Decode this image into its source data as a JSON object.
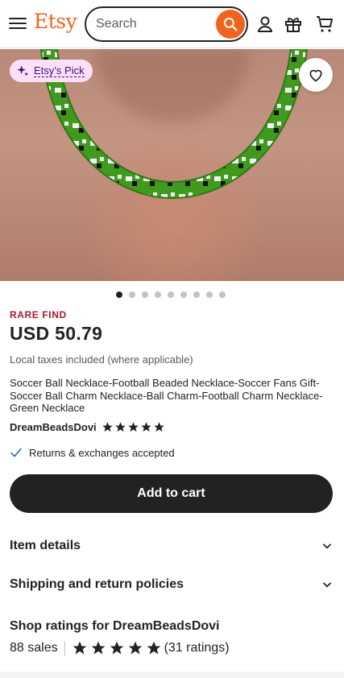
{
  "header": {
    "logo": "Etsy",
    "search_placeholder": "Search",
    "icons": [
      "hamburger-menu-icon",
      "search-icon",
      "account-icon",
      "gift-icon",
      "cart-icon"
    ]
  },
  "hero": {
    "badge_label": "Etsy’s Pick",
    "carousel": {
      "total": 9,
      "active": 1
    }
  },
  "listing": {
    "tag": "RARE FIND",
    "price": "USD 50.79",
    "taxes_note": "Local taxes included (where applicable)",
    "title": "Soccer Ball Necklace-Football Beaded Necklace-Soccer Fans Gift-Soccer Ball Charm Necklace-Ball Charm-Football Charm Necklace-Green Necklace",
    "shop_name": "DreamBeadsDovi",
    "shop_rating_stars": 5,
    "returns_note": "Returns & exchanges accepted",
    "add_to_cart_label": "Add to cart"
  },
  "sections": {
    "item_details": "Item details",
    "shipping": "Shipping and return policies"
  },
  "shop_ratings": {
    "heading": "Shop ratings for DreamBeadsDovi",
    "sales": "88 sales",
    "rating_count": "(31 ratings)",
    "stars": 5
  },
  "colors": {
    "brand": "#f1641e",
    "rare_find": "#a61a2e",
    "badge_bg": "#fde0f5",
    "badge_text": "#3b0d8f",
    "cart_button": "#222222",
    "check": "#2a5bd7"
  }
}
